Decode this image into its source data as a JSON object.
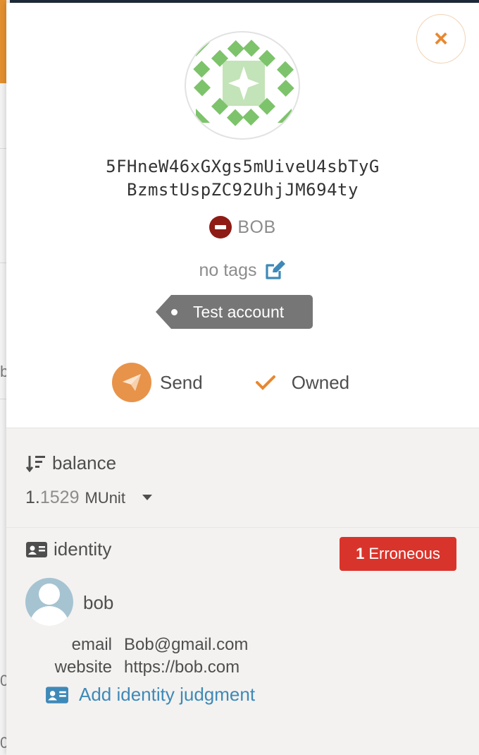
{
  "account": {
    "address_line1": "5FHneW46xGXgs5mUiveU4sbTyG",
    "address_line2": "BzmstUspZC92UhjJM694ty",
    "name": "BOB",
    "tags": "no tags",
    "tag_badge": "Test account"
  },
  "actions": {
    "send_label": "Send",
    "owned_label": "Owned"
  },
  "balance": {
    "title": "balance",
    "int_part": "1.",
    "frac_part": "1529",
    "unit": "MUnit"
  },
  "identity": {
    "title": "identity",
    "badge_count": "1",
    "badge_label": "Erroneous",
    "display_name": "bob",
    "email_label": "email",
    "email_value": "Bob@gmail.com",
    "website_label": "website",
    "website_value": "https://bob.com",
    "add_judgment": "Add identity judgment"
  },
  "background": {
    "edge_chars": [
      "b",
      "0",
      "0"
    ]
  },
  "colors": {
    "accent": "#e8882f",
    "danger": "#d9342b",
    "link": "#3e89b8",
    "identicon_dark": "#7dc36b",
    "identicon_light": "#c3e3b8"
  }
}
